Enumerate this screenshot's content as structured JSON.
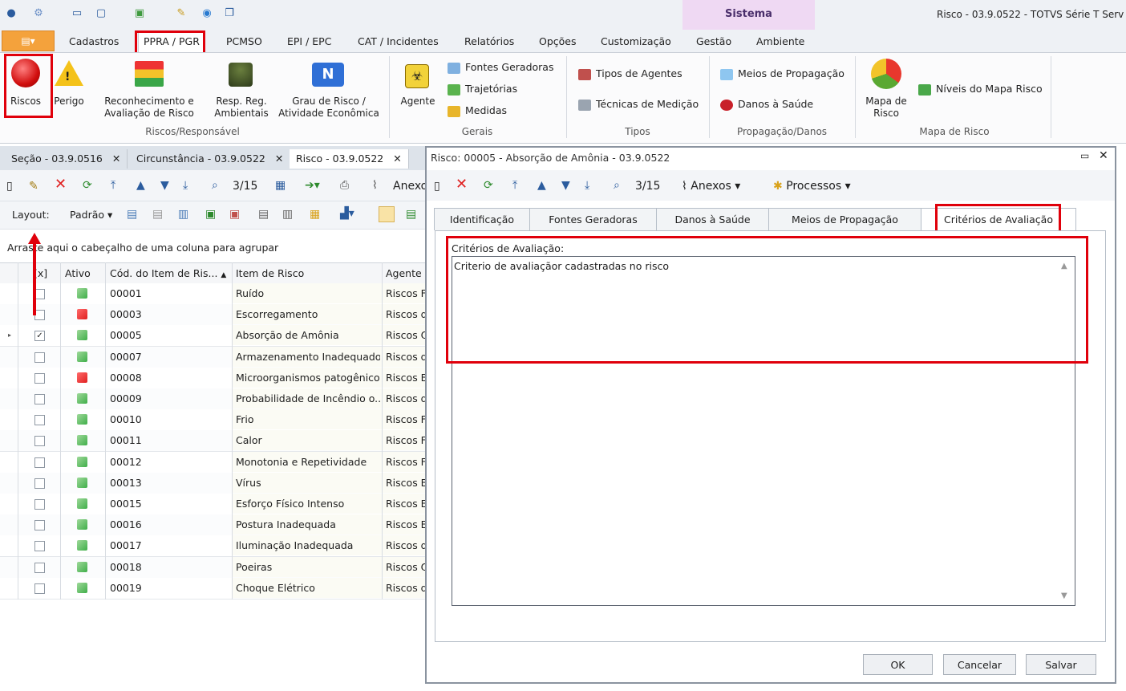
{
  "window": {
    "title": "Risco - 03.9.0522 - TOTVS Série T Serv",
    "context_tab": "Sistema"
  },
  "ribbon_tabs": [
    "Cadastros",
    "PPRA / PGR",
    "PCMSO",
    "EPI / EPC",
    "CAT / Incidentes",
    "Relatórios",
    "Opções",
    "Customização",
    "Gestão",
    "Ambiente"
  ],
  "ribbon": {
    "riscos": "Riscos",
    "perigo": "Perigo",
    "reconhecimento_1": "Reconhecimento e",
    "reconhecimento_2": "Avaliação de Risco",
    "resp_1": "Resp. Reg.",
    "resp_2": "Ambientais",
    "grau_1": "Grau de Risco /",
    "grau_2": "Atividade Econômica",
    "group1": "Riscos/Responsável",
    "agente": "Agente",
    "fontes": "Fontes Geradoras",
    "trajetorias": "Trajetórias",
    "medidas": "Medidas",
    "group2": "Gerais",
    "tipos_agentes": "Tipos de Agentes",
    "tecnicas": "Técnicas de Medição",
    "group3": "Tipos",
    "meios": "Meios de Propagação",
    "danos": "Danos à Saúde",
    "group4": "Propagação/Danos",
    "mapa_1": "Mapa de",
    "mapa_2": "Risco",
    "niveis": "Níveis do Mapa Risco",
    "group5": "Mapa de Risco"
  },
  "doc_tabs": [
    "Seção - 03.9.0516",
    "Circunstância - 03.9.0522",
    "Risco - 03.9.0522"
  ],
  "left_toolbar": {
    "counter": "3/15",
    "anexos": "Anexo",
    "layout": "Layout:",
    "padrao": "Padrão"
  },
  "group_hint": "Arraste aqui o cabeçalho de uma coluna para agrupar",
  "grid": {
    "columns": [
      "[x]",
      "Ativo",
      "Cód. do Item de Ris...",
      "Item de Risco",
      "Agente"
    ],
    "rows": [
      {
        "code": "00001",
        "item": "Ruído",
        "agente": "Riscos F",
        "ativo": "green",
        "checked": false
      },
      {
        "code": "00003",
        "item": "Escorregamento",
        "agente": "Riscos d",
        "ativo": "red",
        "checked": false
      },
      {
        "code": "00005",
        "item": "Absorção de Amônia",
        "agente": "Riscos Q",
        "ativo": "green",
        "checked": true
      },
      {
        "code": "00007",
        "item": "Armazenamento Inadequado",
        "agente": "Riscos d",
        "ativo": "green",
        "checked": false
      },
      {
        "code": "00008",
        "item": "Microorganismos patogênicos",
        "agente": "Riscos B",
        "ativo": "red",
        "checked": false
      },
      {
        "code": "00009",
        "item": "Probabilidade de Incêndio o...",
        "agente": "Riscos d",
        "ativo": "green",
        "checked": false
      },
      {
        "code": "00010",
        "item": "Frio",
        "agente": "Riscos F",
        "ativo": "green",
        "checked": false
      },
      {
        "code": "00011",
        "item": "Calor",
        "agente": "Riscos F",
        "ativo": "green",
        "checked": false
      },
      {
        "code": "00012",
        "item": "Monotonia e Repetividade",
        "agente": "Riscos F",
        "ativo": "green",
        "checked": false
      },
      {
        "code": "00013",
        "item": "Vírus",
        "agente": "Riscos B",
        "ativo": "green",
        "checked": false
      },
      {
        "code": "00015",
        "item": "Esforço Físico Intenso",
        "agente": "Riscos E",
        "ativo": "green",
        "checked": false
      },
      {
        "code": "00016",
        "item": "Postura Inadequada",
        "agente": "Riscos E",
        "ativo": "green",
        "checked": false
      },
      {
        "code": "00017",
        "item": "Iluminação Inadequada",
        "agente": "Riscos d",
        "ativo": "green",
        "checked": false
      },
      {
        "code": "00018",
        "item": "Poeiras",
        "agente": "Riscos Q",
        "ativo": "green",
        "checked": false
      },
      {
        "code": "00019",
        "item": "Choque Elétrico",
        "agente": "Riscos d",
        "ativo": "green",
        "checked": false
      }
    ]
  },
  "dialog": {
    "title": "Risco: 00005 - Absorção de Amônia - 03.9.0522",
    "counter": "3/15",
    "anexos": "Anexos",
    "processos": "Processos",
    "tabs": [
      "Identificação",
      "Fontes Geradoras",
      "Danos à Saúde",
      "Meios de Propagação",
      "Critérios de Avaliação"
    ],
    "field_label": "Critérios de Avaliação:",
    "field_value": "Criterio de avaliaçãor cadastradas no risco",
    "ok": "OK",
    "cancelar": "Cancelar",
    "salvar": "Salvar"
  },
  "colors": {
    "highlight": "#e0000b",
    "green_status": "#3fae49",
    "red_status": "#e02020"
  }
}
